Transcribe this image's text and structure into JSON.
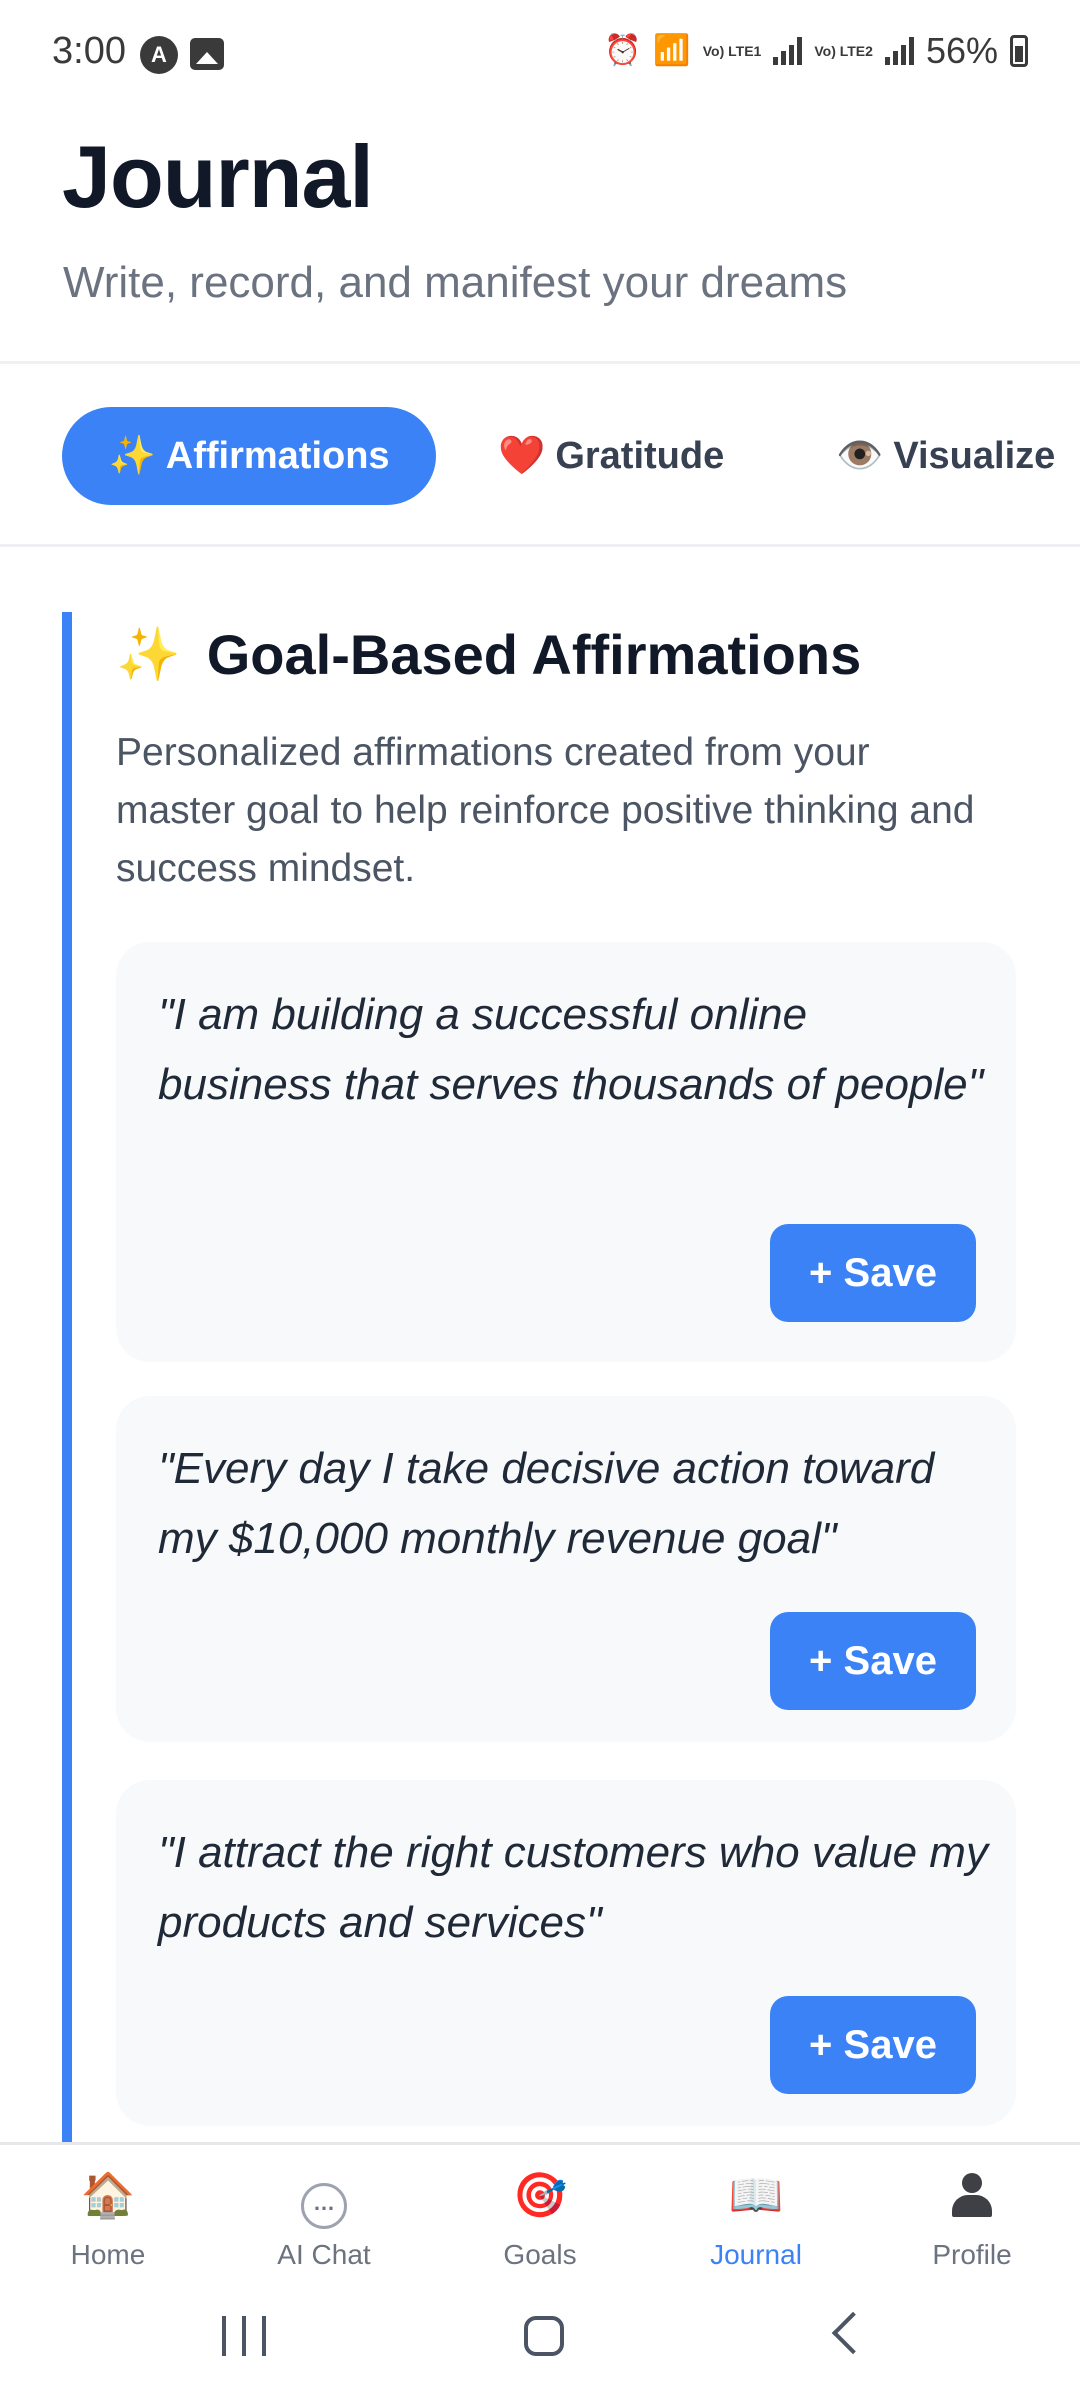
{
  "status_bar": {
    "time": "3:00",
    "lte1": "Vo) LTE1",
    "lte2": "Vo) LTE2",
    "battery": "56%",
    "icons": [
      "notification-a-icon",
      "image-icon",
      "alarm-icon",
      "wifi-icon",
      "signal-icon",
      "battery-icon"
    ]
  },
  "header": {
    "title": "Journal",
    "subtitle": "Write, record, and manifest your dreams"
  },
  "tabs": [
    {
      "icon": "✨",
      "label": "Affirmations",
      "active": true
    },
    {
      "icon": "❤️",
      "label": "Gratitude",
      "active": false
    },
    {
      "icon": "👁️",
      "label": "Visualize",
      "active": false
    }
  ],
  "section": {
    "icon": "✨",
    "title": "Goal-Based Affirmations",
    "description": "Personalized affirmations created from your master goal to help reinforce positive thinking and success mindset."
  },
  "affirmations": [
    {
      "quote": "\"I am building a successful online business that serves thousands of people\"",
      "save_label": "+ Save"
    },
    {
      "quote": "\"Every day I take decisive action toward my $10,000 monthly revenue goal\"",
      "save_label": "+ Save"
    },
    {
      "quote": "\"I attract the right customers who value my products and services\"",
      "save_label": "+ Save"
    }
  ],
  "bottom_nav": [
    {
      "icon": "🏠",
      "label": "Home",
      "active": false
    },
    {
      "icon": "…",
      "label": "AI Chat",
      "active": false
    },
    {
      "icon": "🎯",
      "label": "Goals",
      "active": false
    },
    {
      "icon": "📖",
      "label": "Journal",
      "active": true
    },
    {
      "icon": "👤",
      "label": "Profile",
      "active": false
    }
  ],
  "colors": {
    "accent": "#3b82f6",
    "title": "#111827",
    "subtitle": "#6b7280",
    "card_bg": "#f8f9fb"
  }
}
